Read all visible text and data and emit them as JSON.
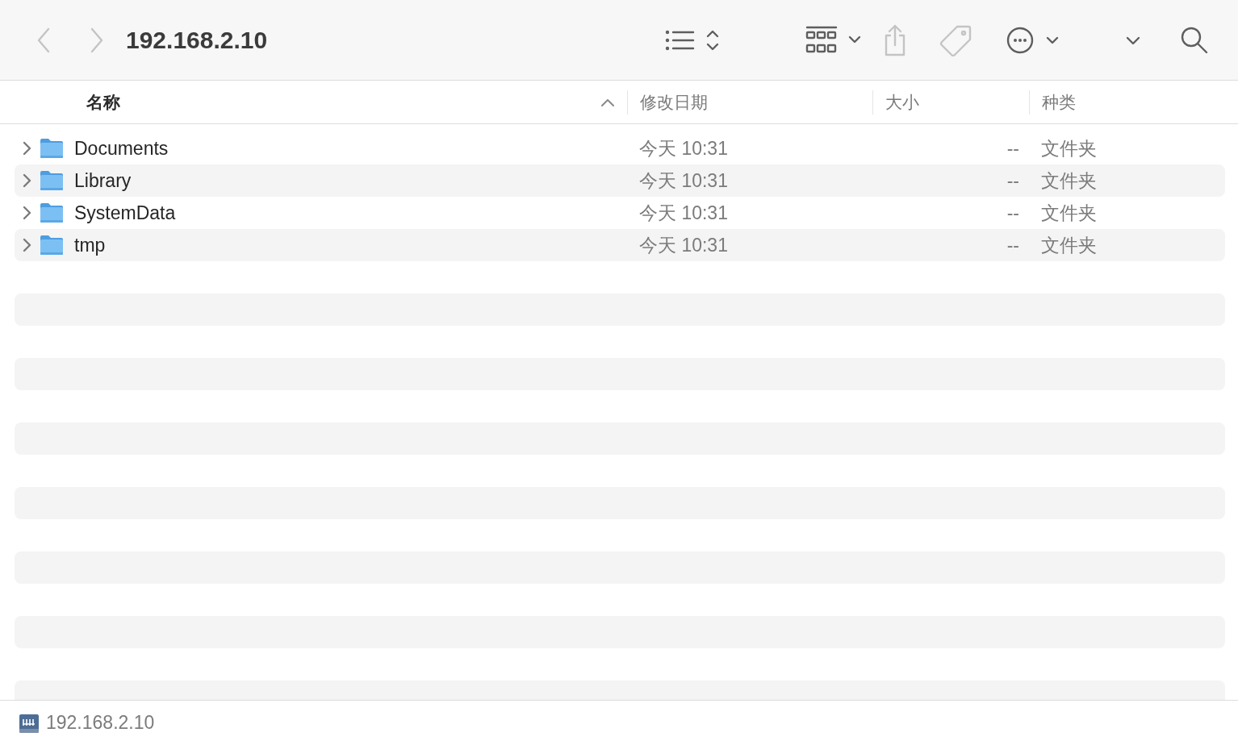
{
  "window": {
    "title": "192.168.2.10"
  },
  "toolbar": [
    {
      "kind": "back",
      "disabled": true
    },
    {
      "kind": "forward",
      "disabled": true
    },
    {
      "kind": "list-view",
      "disabled": false
    },
    {
      "kind": "group",
      "disabled": false
    },
    {
      "kind": "share",
      "disabled": true
    },
    {
      "kind": "tag",
      "disabled": true
    },
    {
      "kind": "more",
      "disabled": false
    },
    {
      "kind": "overflow",
      "disabled": false
    },
    {
      "kind": "search",
      "disabled": false
    }
  ],
  "columns": [
    {
      "label": "名称",
      "sorted": true
    },
    {
      "label": "修改日期",
      "sorted": false
    },
    {
      "label": "大小",
      "sorted": false
    },
    {
      "label": "种类",
      "sorted": false
    }
  ],
  "rows": [
    {
      "name": "Documents",
      "modified": "今天 10:31",
      "size": "--",
      "kind": "文件夹",
      "expanded": false
    },
    {
      "name": "Library",
      "modified": "今天 10:31",
      "size": "--",
      "kind": "文件夹",
      "expanded": false
    },
    {
      "name": "SystemData",
      "modified": "今天 10:31",
      "size": "--",
      "kind": "文件夹",
      "expanded": false
    },
    {
      "name": "tmp",
      "modified": "今天 10:31",
      "size": "--",
      "kind": "文件夹",
      "expanded": false
    }
  ],
  "status_bar": {
    "location": "192.168.2.10"
  }
}
